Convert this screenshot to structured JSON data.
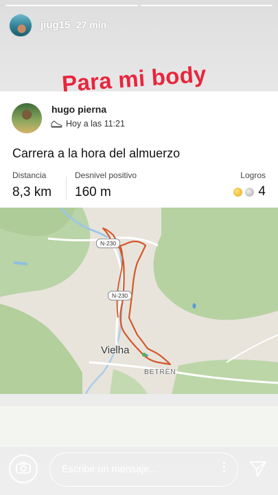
{
  "story": {
    "username": "jiug15",
    "time_ago": "27 min",
    "sticker_text": "Para mi body"
  },
  "activity": {
    "athlete_name": "hugo pierna",
    "timestamp": "Hoy a las 11:21",
    "title": "Carrera a la hora del almuerzo",
    "stats": {
      "distance_label": "Distancia",
      "distance_value": "8,3 km",
      "elevation_label": "Desnivel positivo",
      "elevation_value": "160 m",
      "achievements_label": "Logros",
      "achievements_value": "4"
    },
    "icons": {
      "activity_type": "shoe-icon",
      "medals": [
        "gold-medal-icon",
        "silver-medal-icon"
      ]
    }
  },
  "map": {
    "road_labels": [
      "N-230",
      "N-230"
    ],
    "town_labels": [
      "Vielha",
      "BETRÉN"
    ],
    "route_color": "#d4572b"
  },
  "composer": {
    "placeholder": "Escribe un mensaje...",
    "icons": [
      "camera-icon",
      "more-dots-icon",
      "send-icon"
    ]
  },
  "colors": {
    "sticker": "#e8263d",
    "gold": "#e0a81e",
    "silver": "#a9a9a9"
  }
}
